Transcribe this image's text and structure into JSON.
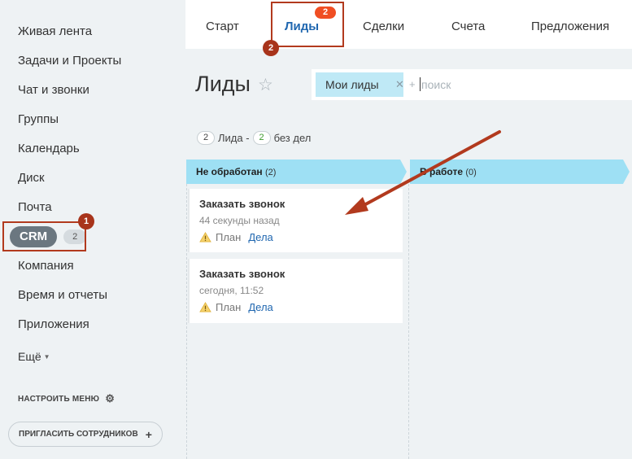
{
  "sidebar": {
    "items": [
      {
        "label": "Живая лента"
      },
      {
        "label": "Задачи и Проекты"
      },
      {
        "label": "Чат и звонки"
      },
      {
        "label": "Группы"
      },
      {
        "label": "Календарь"
      },
      {
        "label": "Диск"
      },
      {
        "label": "Почта"
      },
      {
        "label": "CRM",
        "count": "2"
      },
      {
        "label": "Компания"
      },
      {
        "label": "Время и отчеты"
      },
      {
        "label": "Приложения"
      },
      {
        "label": "Ещё"
      }
    ],
    "settings_label": "НАСТРОИТЬ МЕНЮ",
    "invite_label": "ПРИГЛАСИТЬ СОТРУДНИКОВ",
    "invite_icon": "plus-icon",
    "settings_icon": "gear-icon"
  },
  "annotations": {
    "marker_1": "1",
    "marker_2": "2"
  },
  "tabs": [
    {
      "label": "Старт"
    },
    {
      "label": "Лиды",
      "count": "2",
      "active": true
    },
    {
      "label": "Сделки"
    },
    {
      "label": "Счета"
    },
    {
      "label": "Предложения"
    }
  ],
  "page": {
    "title": "Лиды",
    "star_icon": "star-icon"
  },
  "search": {
    "chip_label": "Мои лиды",
    "plus": "+",
    "placeholder": "поиск"
  },
  "counters": {
    "leads_count": "2",
    "leads_label": "Лида -",
    "no_tasks_count": "2",
    "no_tasks_label": "без дел"
  },
  "columns": [
    {
      "title": "Не обработан",
      "count": "(2)"
    },
    {
      "title": "В работе",
      "count": "(0)"
    }
  ],
  "cards": [
    {
      "title": "Заказать звонок",
      "time": "44 секунды назад",
      "plan": "План",
      "deals": "Дела"
    },
    {
      "title": "Заказать звонок",
      "time": "сегодня, 11:52",
      "plan": "План",
      "deals": "Дела"
    }
  ],
  "colors": {
    "accent": "#2067b0",
    "column_header": "#9ee0f4",
    "annotation_red": "#b23a1e",
    "tab_badge": "#f04e23"
  }
}
